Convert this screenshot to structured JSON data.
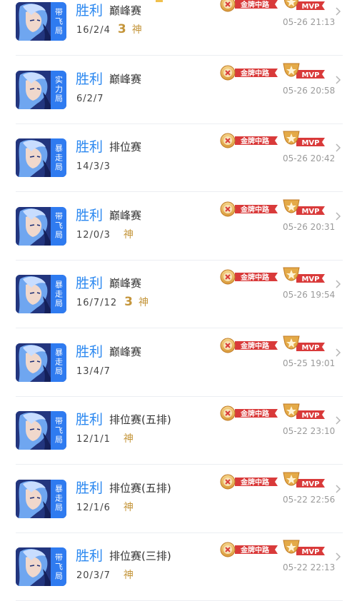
{
  "colors": {
    "win": "#2b88f0",
    "gold": "#c4953a",
    "badge_red": "#d93a3a",
    "tag_blue": "#2f7bf0"
  },
  "badges": {
    "gold_label": "金牌中路",
    "mvp_label": "MVP"
  },
  "matches": [
    {
      "tag": "带飞局",
      "result": "胜利",
      "mode": "巅峰赛",
      "kda": "16/2/4",
      "triple": "3",
      "god": "神",
      "time": "05-26 21:13"
    },
    {
      "tag": "实力局",
      "result": "胜利",
      "mode": "巅峰赛",
      "kda": "6/2/7",
      "triple": "",
      "god": "",
      "time": "05-26 20:58"
    },
    {
      "tag": "暴走局",
      "result": "胜利",
      "mode": "排位赛",
      "kda": "14/3/3",
      "triple": "",
      "god": "",
      "time": "05-26 20:42"
    },
    {
      "tag": "带飞局",
      "result": "胜利",
      "mode": "巅峰赛",
      "kda": "12/0/3",
      "triple": "",
      "god": "神",
      "time": "05-26 20:31"
    },
    {
      "tag": "暴走局",
      "result": "胜利",
      "mode": "巅峰赛",
      "kda": "16/7/12",
      "triple": "3",
      "god": "神",
      "time": "05-26 19:54"
    },
    {
      "tag": "暴走局",
      "result": "胜利",
      "mode": "巅峰赛",
      "kda": "13/4/7",
      "triple": "",
      "god": "",
      "time": "05-25 19:01"
    },
    {
      "tag": "带飞局",
      "result": "胜利",
      "mode": "排位赛(五排)",
      "kda": "12/1/1",
      "triple": "",
      "god": "神",
      "time": "05-22 23:10"
    },
    {
      "tag": "暴走局",
      "result": "胜利",
      "mode": "排位赛(五排)",
      "kda": "12/1/6",
      "triple": "",
      "god": "神",
      "time": "05-22 22:56"
    },
    {
      "tag": "带飞局",
      "result": "胜利",
      "mode": "排位赛(三排)",
      "kda": "20/3/7",
      "triple": "",
      "god": "神",
      "time": "05-22 22:13"
    }
  ]
}
